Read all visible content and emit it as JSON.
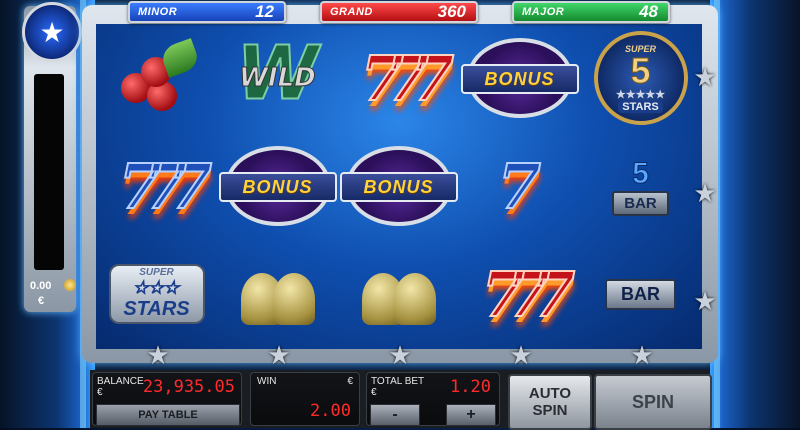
{
  "jackpots": {
    "minor": {
      "label": "MINOR",
      "value": "12"
    },
    "grand": {
      "label": "GRAND",
      "value": "360"
    },
    "major": {
      "label": "MAJOR",
      "value": "48"
    }
  },
  "meter": {
    "value": "0.00",
    "currency": "€"
  },
  "reels": [
    [
      "cherries",
      "seven-blue",
      "super-stars"
    ],
    [
      "wild",
      "bonus",
      "bells"
    ],
    [
      "seven-red",
      "bonus",
      "bells"
    ],
    [
      "bonus",
      "seven-blue",
      "seven-red"
    ],
    [
      "super-5-stars",
      "5-bar",
      "bar"
    ]
  ],
  "symbols": {
    "wild_text": "WILD",
    "bonus_text": "BONUS",
    "super_stars_top": "SUPER",
    "super_stars_main": "STARS",
    "super5_top": "SUPER",
    "super5_num": "5",
    "super5_bottom": "STARS",
    "fivebar_num": "5",
    "fivebar_bar": "BAR",
    "bar_text": "BAR"
  },
  "console": {
    "balance_label": "BALANCE",
    "balance_currency": "€",
    "balance_value": "23,935.05",
    "win_label": "WIN",
    "win_currency": "€",
    "win_value": "2.00",
    "total_bet_label": "TOTAL BET",
    "total_bet_currency": "€",
    "total_bet_value": "1.20",
    "paytable_label": "PAY TABLE",
    "minus_label": "-",
    "plus_label": "+",
    "auto_spin_line1": "AUTO",
    "auto_spin_line2": "SPIN",
    "spin_label": "SPIN"
  },
  "colors": {
    "minor": "#2a5fe0",
    "grand": "#d61a1e",
    "major": "#22a845",
    "digits": "#ff2a2a"
  }
}
